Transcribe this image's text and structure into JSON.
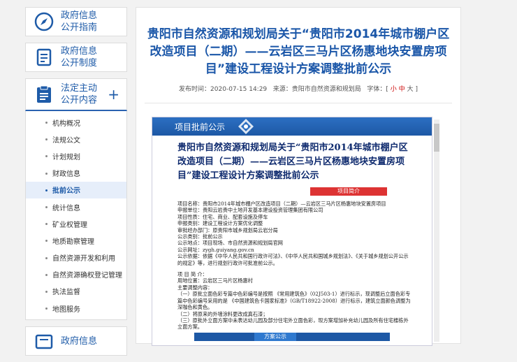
{
  "sidebar": {
    "items": [
      {
        "label": "政府信息\n公开指南"
      },
      {
        "label": "政府信息\n公开制度"
      },
      {
        "label": "法定主动\n公开内容",
        "toggle": "+"
      },
      {
        "label": "政府信息"
      }
    ],
    "subitems": [
      "机构概况",
      "法规公文",
      "计划规划",
      "财政信息",
      "批前公示",
      "统计信息",
      "矿业权管理",
      "地质勘察管理",
      "自然资源开发和利用",
      "自然资源确权登记管理",
      "执法监督",
      "地图服务"
    ]
  },
  "article": {
    "title": "贵阳市自然资源和规划局关于“贵阳市2014年城市棚户区改造项目（二期）——云岩区三马片区杨惠地块安置房项目”建设工程设计方案调整批前公示",
    "publish_label": "发布时间：",
    "publish_time": "2020-07-15 14:29",
    "source_label": "来源：",
    "source": "贵阳市自然资源和规划局",
    "font_label": "字体：[",
    "font_small": "小",
    "font_mid": "中",
    "font_large": "大",
    "font_end": "]"
  },
  "doc": {
    "header": "项目批前公示",
    "title": "贵阳市自然资源和规划局关于“贵阳市2014年城市棚户区改造项目（二期）——云岩区三马片区杨惠地块安置房项目”建设工程设计方案调整批前公示",
    "section1": "项目简介",
    "lines1": [
      "项目名称：贵阳市2014年城市棚户区改造项目（二期）—云岩区三马片区杨惠地块安置房项目",
      "申报单位：贵阳云岩贵中土地开发基本建设投资管理集团有限公司",
      "项目性质：住宅、商业、配套设施及停车",
      "申报类别：建设工程设计方案优化调整",
      "审批经办部门：原贵阳市城乡规划局云岩分局",
      "公示类别：批前公示",
      "公示地点：项目现场、市自然资源和规划局官网",
      "公示网址：zygh.guiyang.gov.cn",
      "公示依据：依据《中华人民共和国行政许可法》、《中华人民共和国城乡规划法》、《关于城乡规划公开公示的规定》等，进行规划行政许可批准前公示。"
    ],
    "lines2": [
      "项 目 简 介：",
      "用地位置：云岩区三马片区杨惠村",
      "主要调整内容：",
      "（一）原批立面色彩专篇中色彩编号是按照 《常用建筑色》（02J503-1）进行标示，现调整后立面色彩专篇中色彩编号采用的是 《中国建筑色卡国家标准》（GB/T18922-2008）进行标示，建筑立面颜色调整为深咖色和黄色。",
      "（二）将原来的外墙涂料更改成真石漆；",
      "（三）原批外立面方案中未表达幼儿园及部分住宅外立面色彩，现方案增加补充幼儿园及所有住宅楼栋外立面方案。"
    ],
    "section2": "方案公示"
  }
}
